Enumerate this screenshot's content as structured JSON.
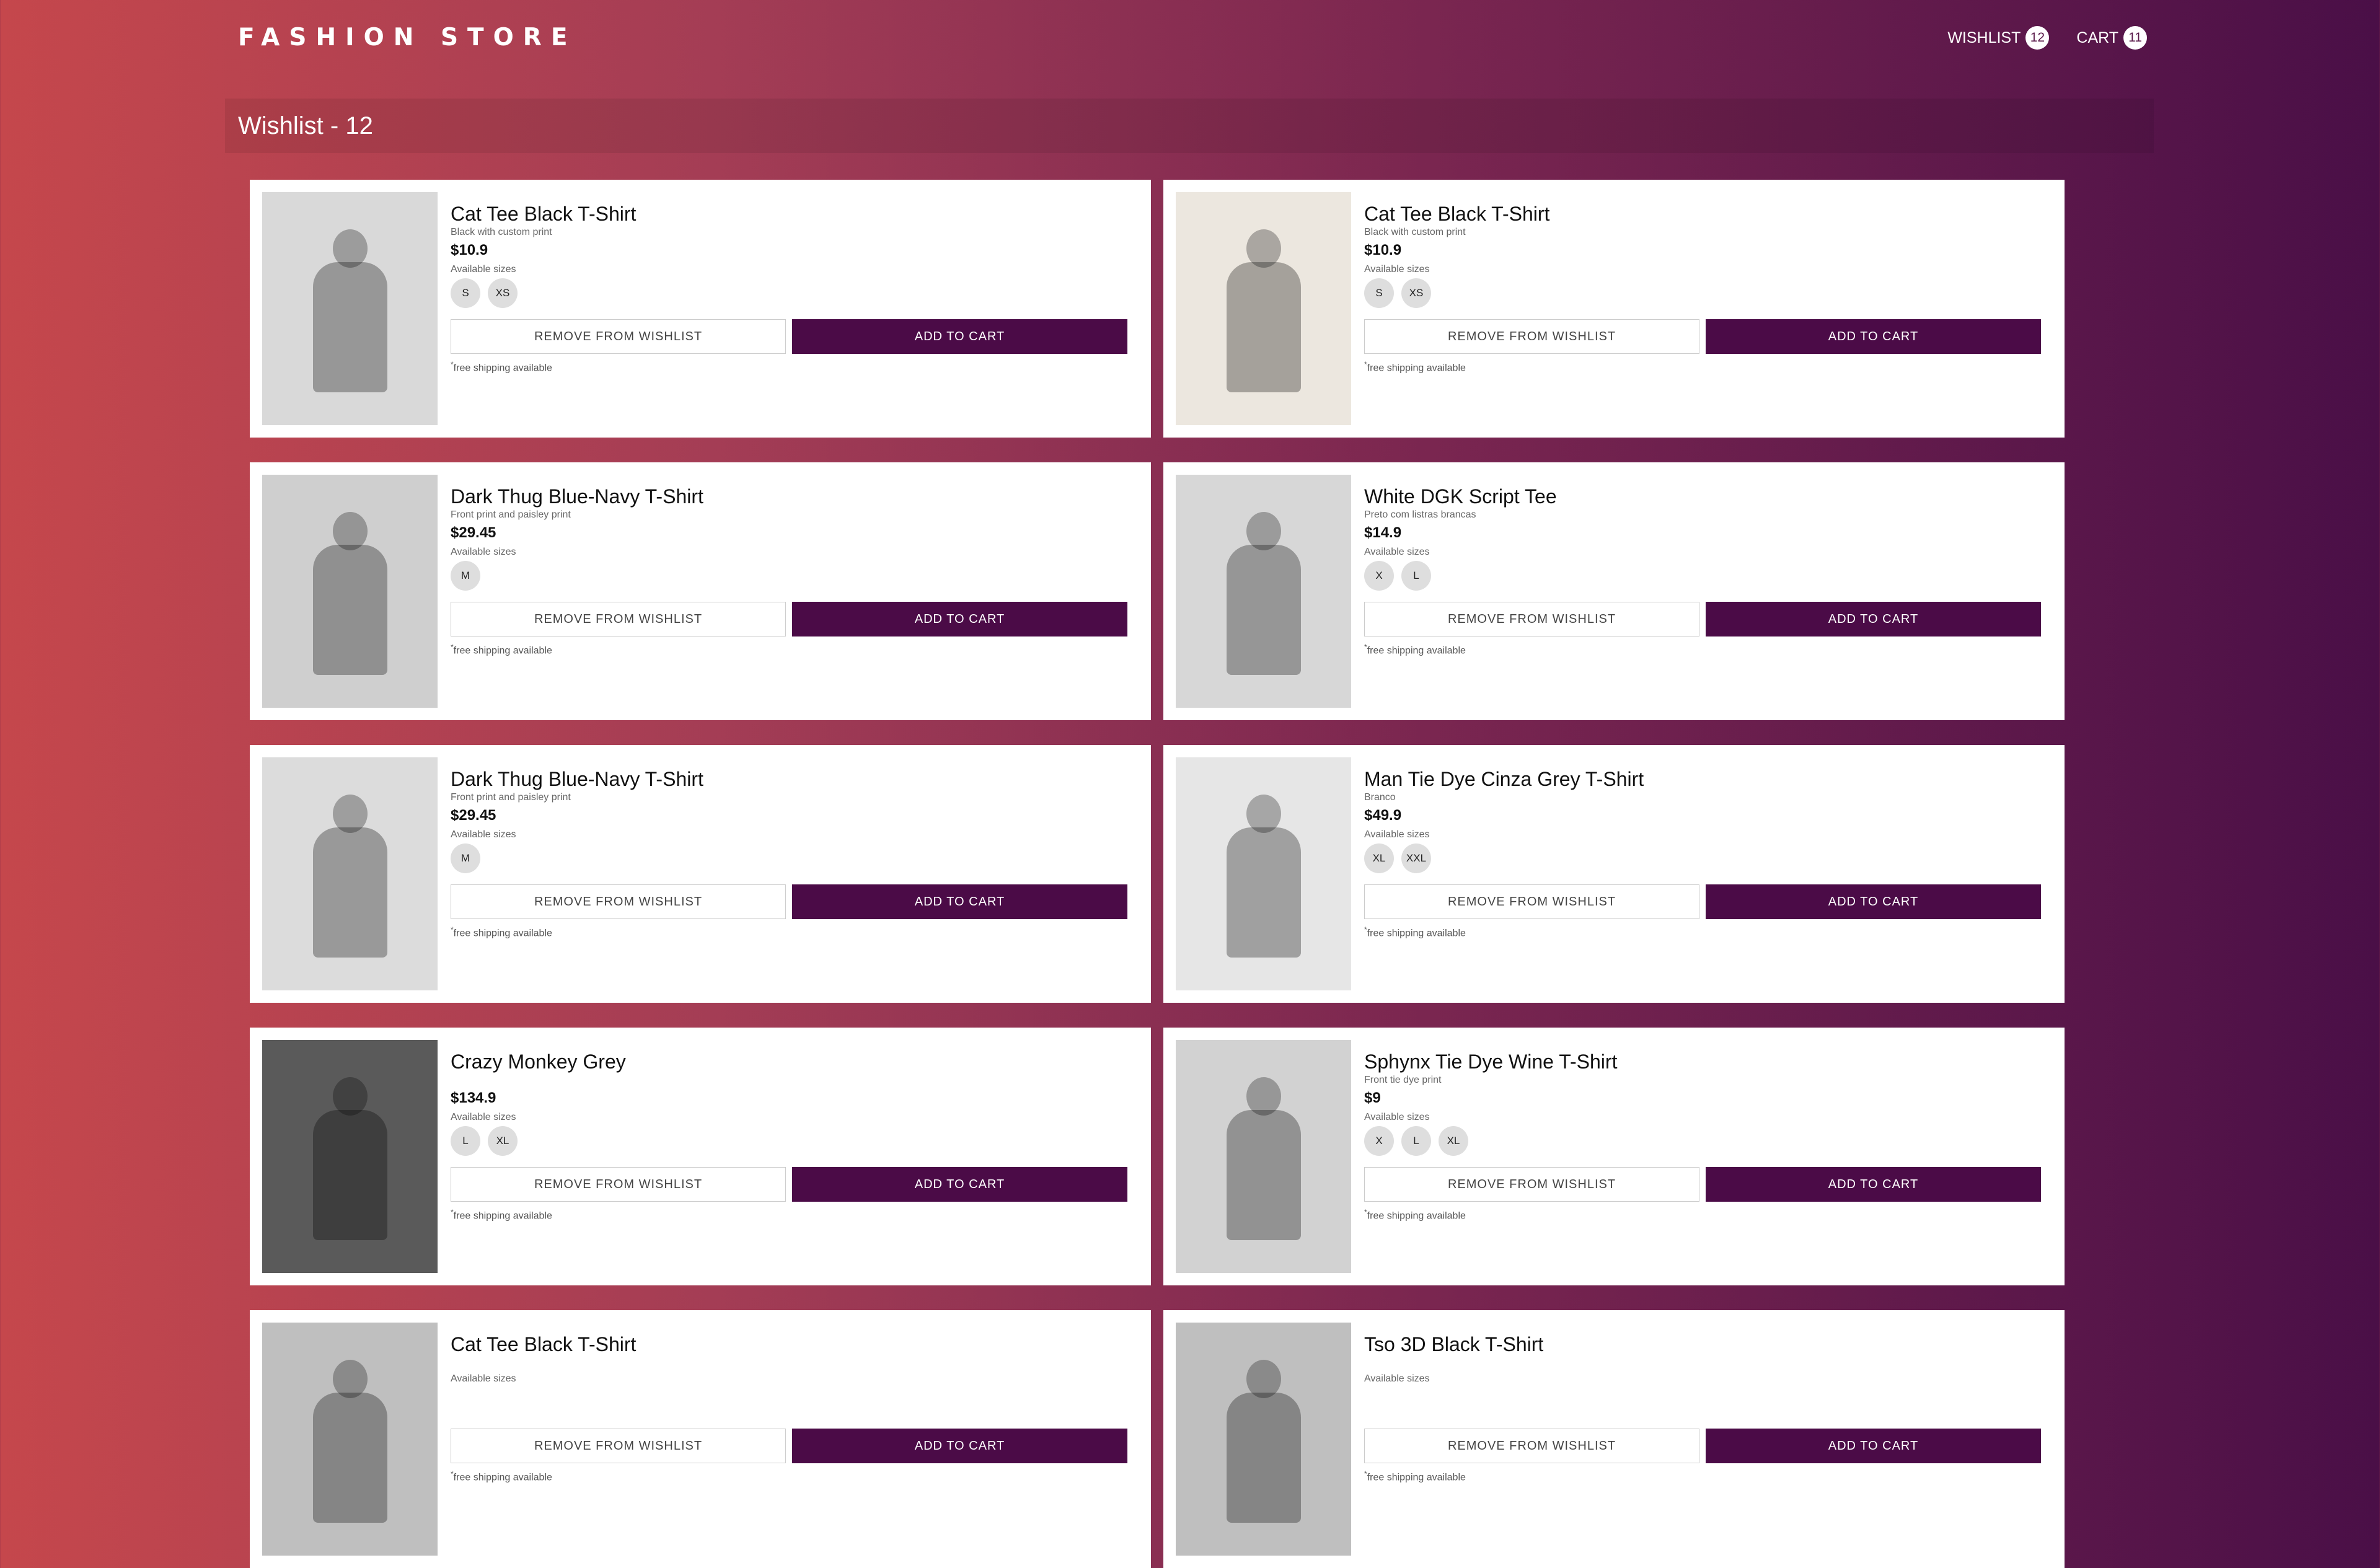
{
  "header": {
    "logo": "FASHION STORE",
    "wishlist_label": "WISHLIST",
    "wishlist_count": "12",
    "cart_label": "CART",
    "cart_count": "11"
  },
  "page_title": "Wishlist - 12",
  "labels": {
    "available_sizes": "Available sizes",
    "remove": "REMOVE FROM WISHLIST",
    "add": "ADD TO CART",
    "shipping_mark": "*",
    "shipping": "free shipping available"
  },
  "colors": {
    "accent": "#4b0b47",
    "gradient_start": "#c5474c",
    "gradient_end": "#4a0f47"
  },
  "products": [
    {
      "name": "Cat Tee Black T-Shirt",
      "desc": "Black with custom print",
      "price": "$10.9",
      "sizes": [
        "S",
        "XS"
      ],
      "img": "#d9d9d9"
    },
    {
      "name": "Cat Tee Black T-Shirt",
      "desc": "Black with custom print",
      "price": "$10.9",
      "sizes": [
        "S",
        "XS"
      ],
      "img": "#ece7df"
    },
    {
      "name": "Dark Thug Blue-Navy T-Shirt",
      "desc": "Front print and paisley print",
      "price": "$29.45",
      "sizes": [
        "M"
      ],
      "img": "#cfcfcf"
    },
    {
      "name": "White DGK Script Tee",
      "desc": "Preto com listras brancas",
      "price": "$14.9",
      "sizes": [
        "X",
        "L"
      ],
      "img": "#d7d7d7"
    },
    {
      "name": "Dark Thug Blue-Navy T-Shirt",
      "desc": "Front print and paisley print",
      "price": "$29.45",
      "sizes": [
        "M"
      ],
      "img": "#dcdcdc"
    },
    {
      "name": "Man Tie Dye Cinza Grey T-Shirt",
      "desc": "Branco",
      "price": "$49.9",
      "sizes": [
        "XL",
        "XXL"
      ],
      "img": "#e6e6e6"
    },
    {
      "name": "Crazy Monkey Grey",
      "desc": "",
      "price": "$134.9",
      "sizes": [
        "L",
        "XL"
      ],
      "img": "#5a5a5a"
    },
    {
      "name": "Sphynx Tie Dye Wine T-Shirt",
      "desc": "Front tie dye print",
      "price": "$9",
      "sizes": [
        "X",
        "L",
        "XL"
      ],
      "img": "#d2d2d2"
    },
    {
      "name": "Cat Tee Black T-Shirt",
      "desc": "",
      "price": "",
      "sizes": [],
      "img": "#bfbfbf"
    },
    {
      "name": "Tso 3D Black T-Shirt",
      "desc": "",
      "price": "",
      "sizes": [],
      "img": "#bfbfbf"
    }
  ]
}
